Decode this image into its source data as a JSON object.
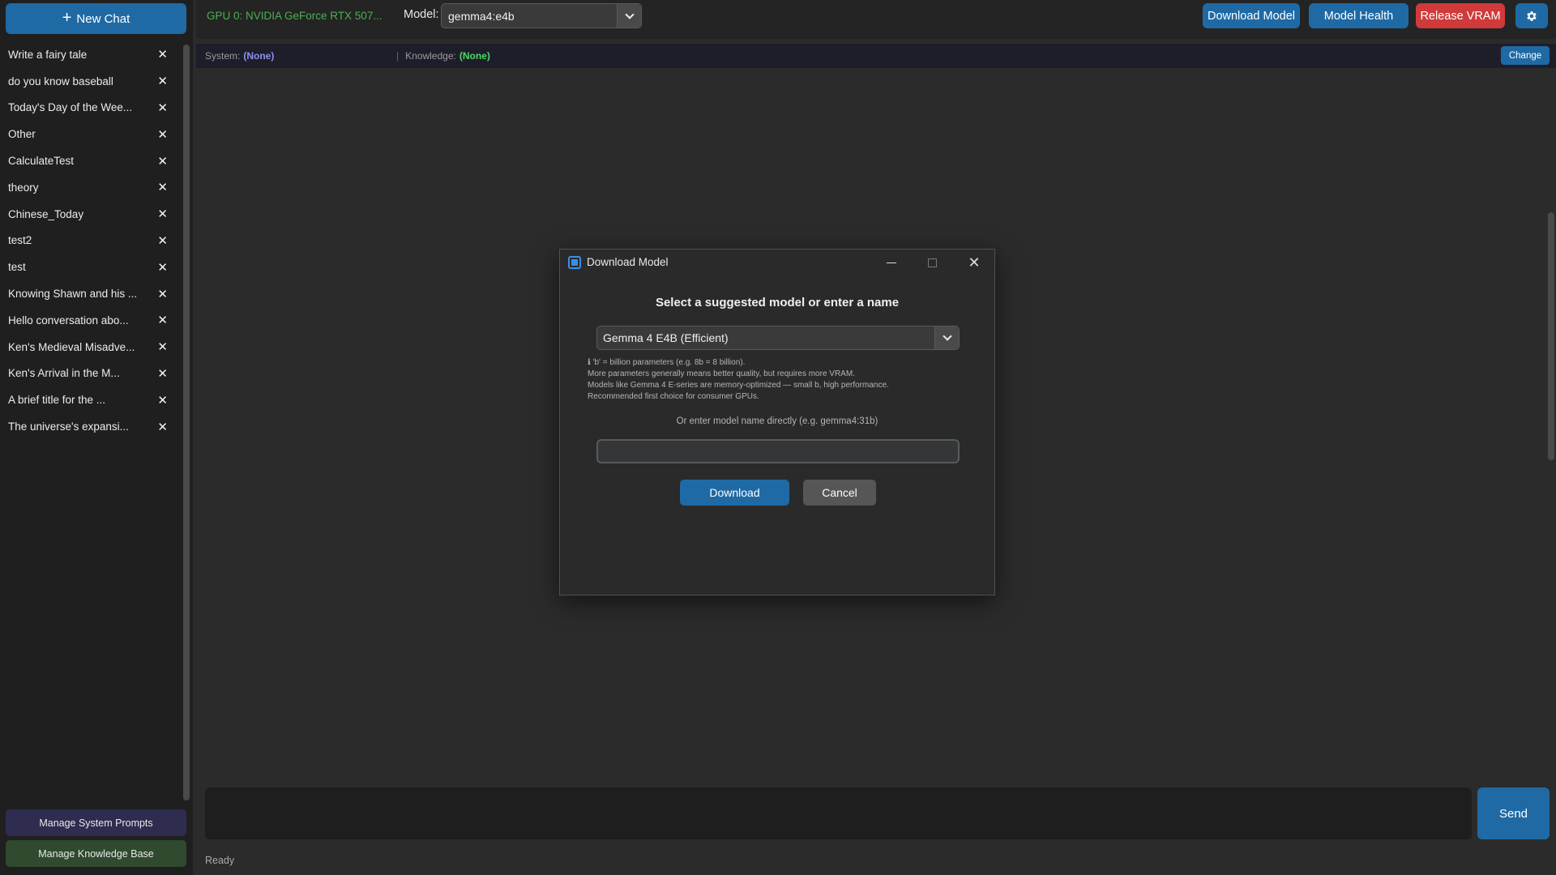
{
  "sidebar": {
    "new_chat_label": "New Chat",
    "chats": [
      "Write a fairy tale",
      "do you know baseball",
      "Today's Day of the Wee...",
      "Other",
      "CalculateTest",
      "theory",
      "Chinese_Today",
      "test2",
      "test",
      "Knowing Shawn and his ...",
      "Hello conversation abo...",
      "Ken's Medieval Misadve...",
      "Ken's Arrival in the M...",
      "A brief title for the ...",
      "The universe's expansi..."
    ],
    "delete_glyph": "✕",
    "manage_prompts_label": "Manage System Prompts",
    "manage_kb_label": "Manage Knowledge Base"
  },
  "topbar": {
    "gpu_text": "GPU 0: NVIDIA GeForce RTX 507...",
    "model_label": "Model:",
    "model_value": "gemma4:e4b",
    "download_model_label": "Download Model",
    "model_health_label": "Model Health",
    "release_vram_label": "Release VRAM",
    "settings_icon": "gear-icon"
  },
  "infobar": {
    "system_label": "System:",
    "system_value": "(None)",
    "knowledge_label": "Knowledge:",
    "knowledge_value": "(None)",
    "separator": "|",
    "change_label": "Change"
  },
  "main": {
    "send_label": "Send",
    "status": "Ready"
  },
  "dialog": {
    "title": "Download Model",
    "heading": "Select a suggested model or enter a name",
    "selected_model": "Gemma 4 E4B (Efficient)",
    "notes": [
      "ℹ 'b' = billion parameters (e.g. 8b = 8 billion).",
      "More parameters generally means better quality, but requires more VRAM.",
      "Models like Gemma 4 E-series are memory-optimized — small b, high performance.",
      "Recommended first choice for consumer GPUs."
    ],
    "or_text": "Or enter model name directly (e.g. gemma4:31b)",
    "name_input_value": "",
    "download_label": "Download",
    "cancel_label": "Cancel"
  },
  "colors": {
    "accent": "#1f6aa5",
    "danger": "#d03a3a",
    "gpu_text": "#4caf50",
    "system_value": "#8f8ff0",
    "knowledge_value": "#4cd964"
  }
}
